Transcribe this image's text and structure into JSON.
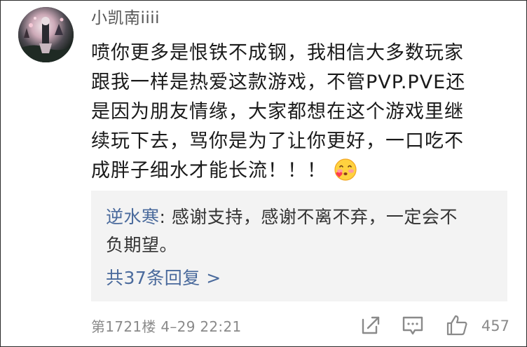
{
  "comment": {
    "username": "小凯南iiii",
    "body_lines": [
      "喷你更多是恨铁不成钢，我相信大多数玩家",
      "跟我一样是热爱这款游戏，不管PVP.PVE还",
      "是因为朋友情缘，大家都想在这个游戏里继",
      "续玩下去，骂你是为了让你更好，一口吃不",
      "成胖子细水才能长流！！！"
    ],
    "emoji": "blushing-face-emoji"
  },
  "reply": {
    "author": "逆水寒",
    "separator": ": ",
    "text_line1": "感谢支持，感谢不离不弃，一定会不",
    "text_line2": "负期望。",
    "count_label": "共37条回复 >"
  },
  "meta": {
    "floor_and_time": "第1721楼 4–29 22:21"
  },
  "actions": {
    "like_count": "457",
    "icons": [
      "share-icon",
      "comment-icon",
      "like-icon"
    ]
  },
  "colors": {
    "link": "#4a6a9c",
    "reply_bg": "#f3f3f3",
    "meta": "#8a8a8a"
  }
}
